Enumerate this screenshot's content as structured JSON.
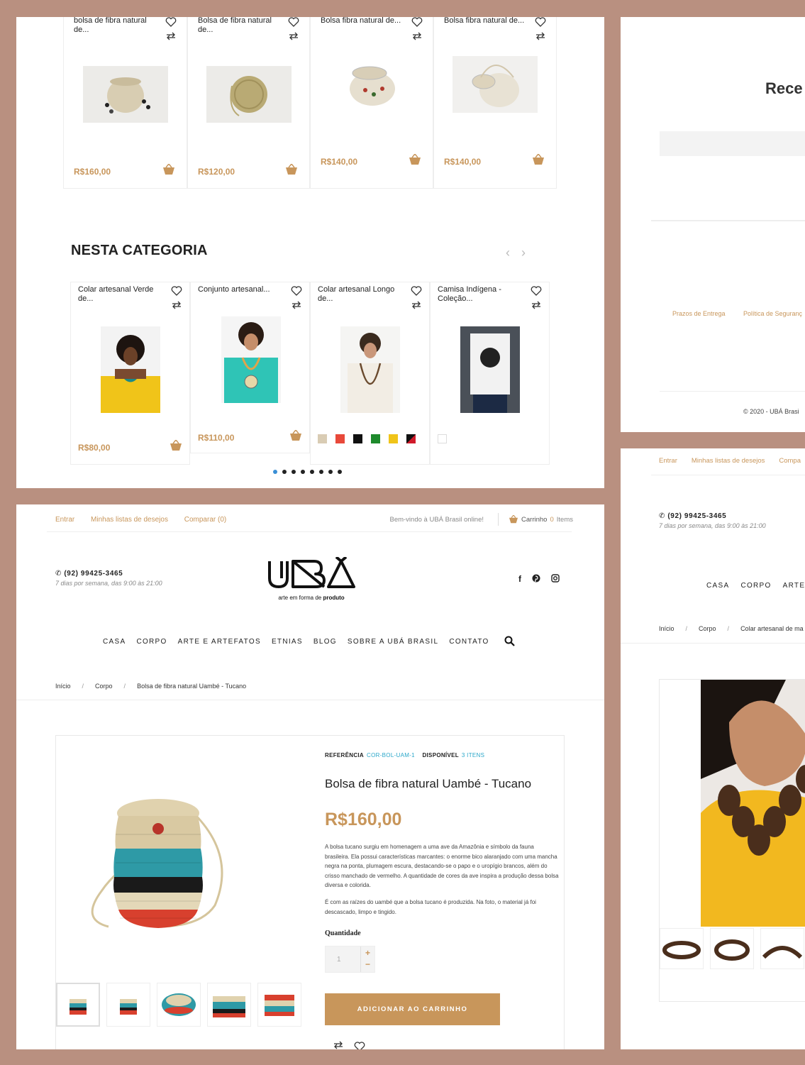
{
  "top_related": [
    {
      "name": "bolsa de fibra natural de...",
      "price": "R$160,00"
    },
    {
      "name": "Bolsa de fibra natural de...",
      "price": "R$120,00"
    },
    {
      "name": "Bolsa fibra natural de...",
      "price": "R$140,00"
    },
    {
      "name": "Bolsa fibra natural de...",
      "price": "R$140,00"
    }
  ],
  "category": {
    "title": "NESTA CATEGORIA",
    "products": [
      {
        "name": "Colar artesanal Verde de...",
        "price": "R$80,00"
      },
      {
        "name": "Conjunto artesanal...",
        "price": "R$110,00"
      },
      {
        "name": "Colar artesanal Longo de...",
        "price": ""
      },
      {
        "name": "Camisa Indígena - Coleção...",
        "price": ""
      }
    ],
    "swatch_colors": [
      "#d9ccb4",
      "#e8493a",
      "#111111",
      "#1e8a2c",
      "#f0c419",
      "#b0122a"
    ],
    "dots_count": 8
  },
  "panel_b": {
    "heading_partial": "Rece",
    "footer_links": [
      "Prazos de Entrega",
      "Política de Seguranç"
    ],
    "copyright": "© 2020 - UBÁ Brasi"
  },
  "panel_c": {
    "top_links": [
      "Entrar",
      "Minhas listas de desejos",
      "Compa"
    ],
    "phone": "(92) 99425-3465",
    "hours": "7 dias por semana, das 9:00 às 21:00",
    "menu": [
      "CASA",
      "CORPO",
      "ARTE I"
    ],
    "breadcrumb": [
      "Início",
      "Corpo",
      "Colar artesanal de ma"
    ]
  },
  "header": {
    "login": "Entrar",
    "wishlist": "Minhas listas de desejos",
    "compare": "Comparar (0)",
    "welcome": "Bem-vindo à UBÁ Brasil online!",
    "cart_label": "Carrinho",
    "cart_count": "0",
    "cart_items": "Items",
    "phone": "(92) 99425-3465",
    "hours": "7 dias por semana, das 9:00 às 21:00",
    "logo_text": "UBÁ",
    "tagline_pre": "arte em forma de",
    "tagline_bold": "produto"
  },
  "menu": [
    "CASA",
    "CORPO",
    "ARTE E ARTEFATOS",
    "ETNIAS",
    "BLOG",
    "SOBRE A UBÁ BRASIL",
    "CONTATO"
  ],
  "breadcrumb": [
    "Início",
    "Corpo",
    "Bolsa de fibra natural Uambé - Tucano"
  ],
  "product": {
    "ref_label": "REFERÊNCIA",
    "ref_value": "COR-BOL-UAM-1",
    "stock_label": "DISPONÍVEL",
    "stock_value": "3 ITENS",
    "title": "Bolsa de fibra natural Uambé - Tucano",
    "price": "R$160,00",
    "desc1": "A bolsa tucano surgiu em homenagem a uma ave da Amazônia e símbolo da fauna brasileira. Ela possui características marcantes: o enorme bico alaranjado com uma mancha negra na ponta, plumagem escura, destacando-se o papo e o uropígio brancos, além do crisso manchado de vermelho. A quantidade de cores da ave inspira a produção dessa bolsa diversa e colorida.",
    "desc2": "É com as raízes do uambé que a bolsa tucano é produzida. Na foto, o material já foi descascado, limpo e tingido.",
    "qty_label": "Quantidade",
    "qty_value": "1",
    "add_to_cart": "ADICIONAR AO CARRINHO"
  }
}
